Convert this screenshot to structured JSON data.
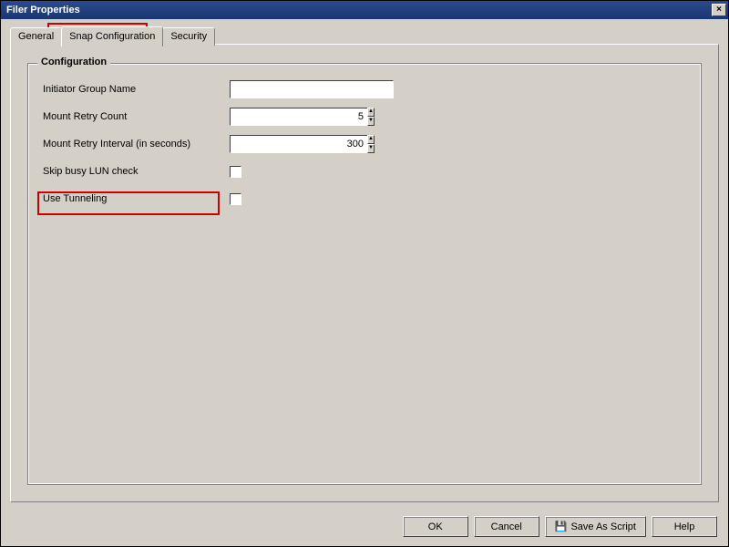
{
  "window": {
    "title": "Filer Properties",
    "close_glyph": "×"
  },
  "tabs": {
    "general": "General",
    "snap": "Snap Configuration",
    "security": "Security"
  },
  "fieldset": {
    "legend": "Configuration",
    "initiator_group_label": "Initiator Group Name",
    "initiator_group_value": "",
    "mount_retry_count_label": "Mount Retry Count",
    "mount_retry_count_value": "5",
    "mount_retry_interval_label": "Mount Retry Interval (in seconds)",
    "mount_retry_interval_value": "300",
    "skip_busy_lun_label": "Skip busy LUN check",
    "use_tunneling_label": "Use Tunneling"
  },
  "spin": {
    "up": "▲",
    "down": "▼"
  },
  "buttons": {
    "ok": "OK",
    "cancel": "Cancel",
    "save_as_script": "Save As Script",
    "help": "Help",
    "save_icon": "💾"
  }
}
